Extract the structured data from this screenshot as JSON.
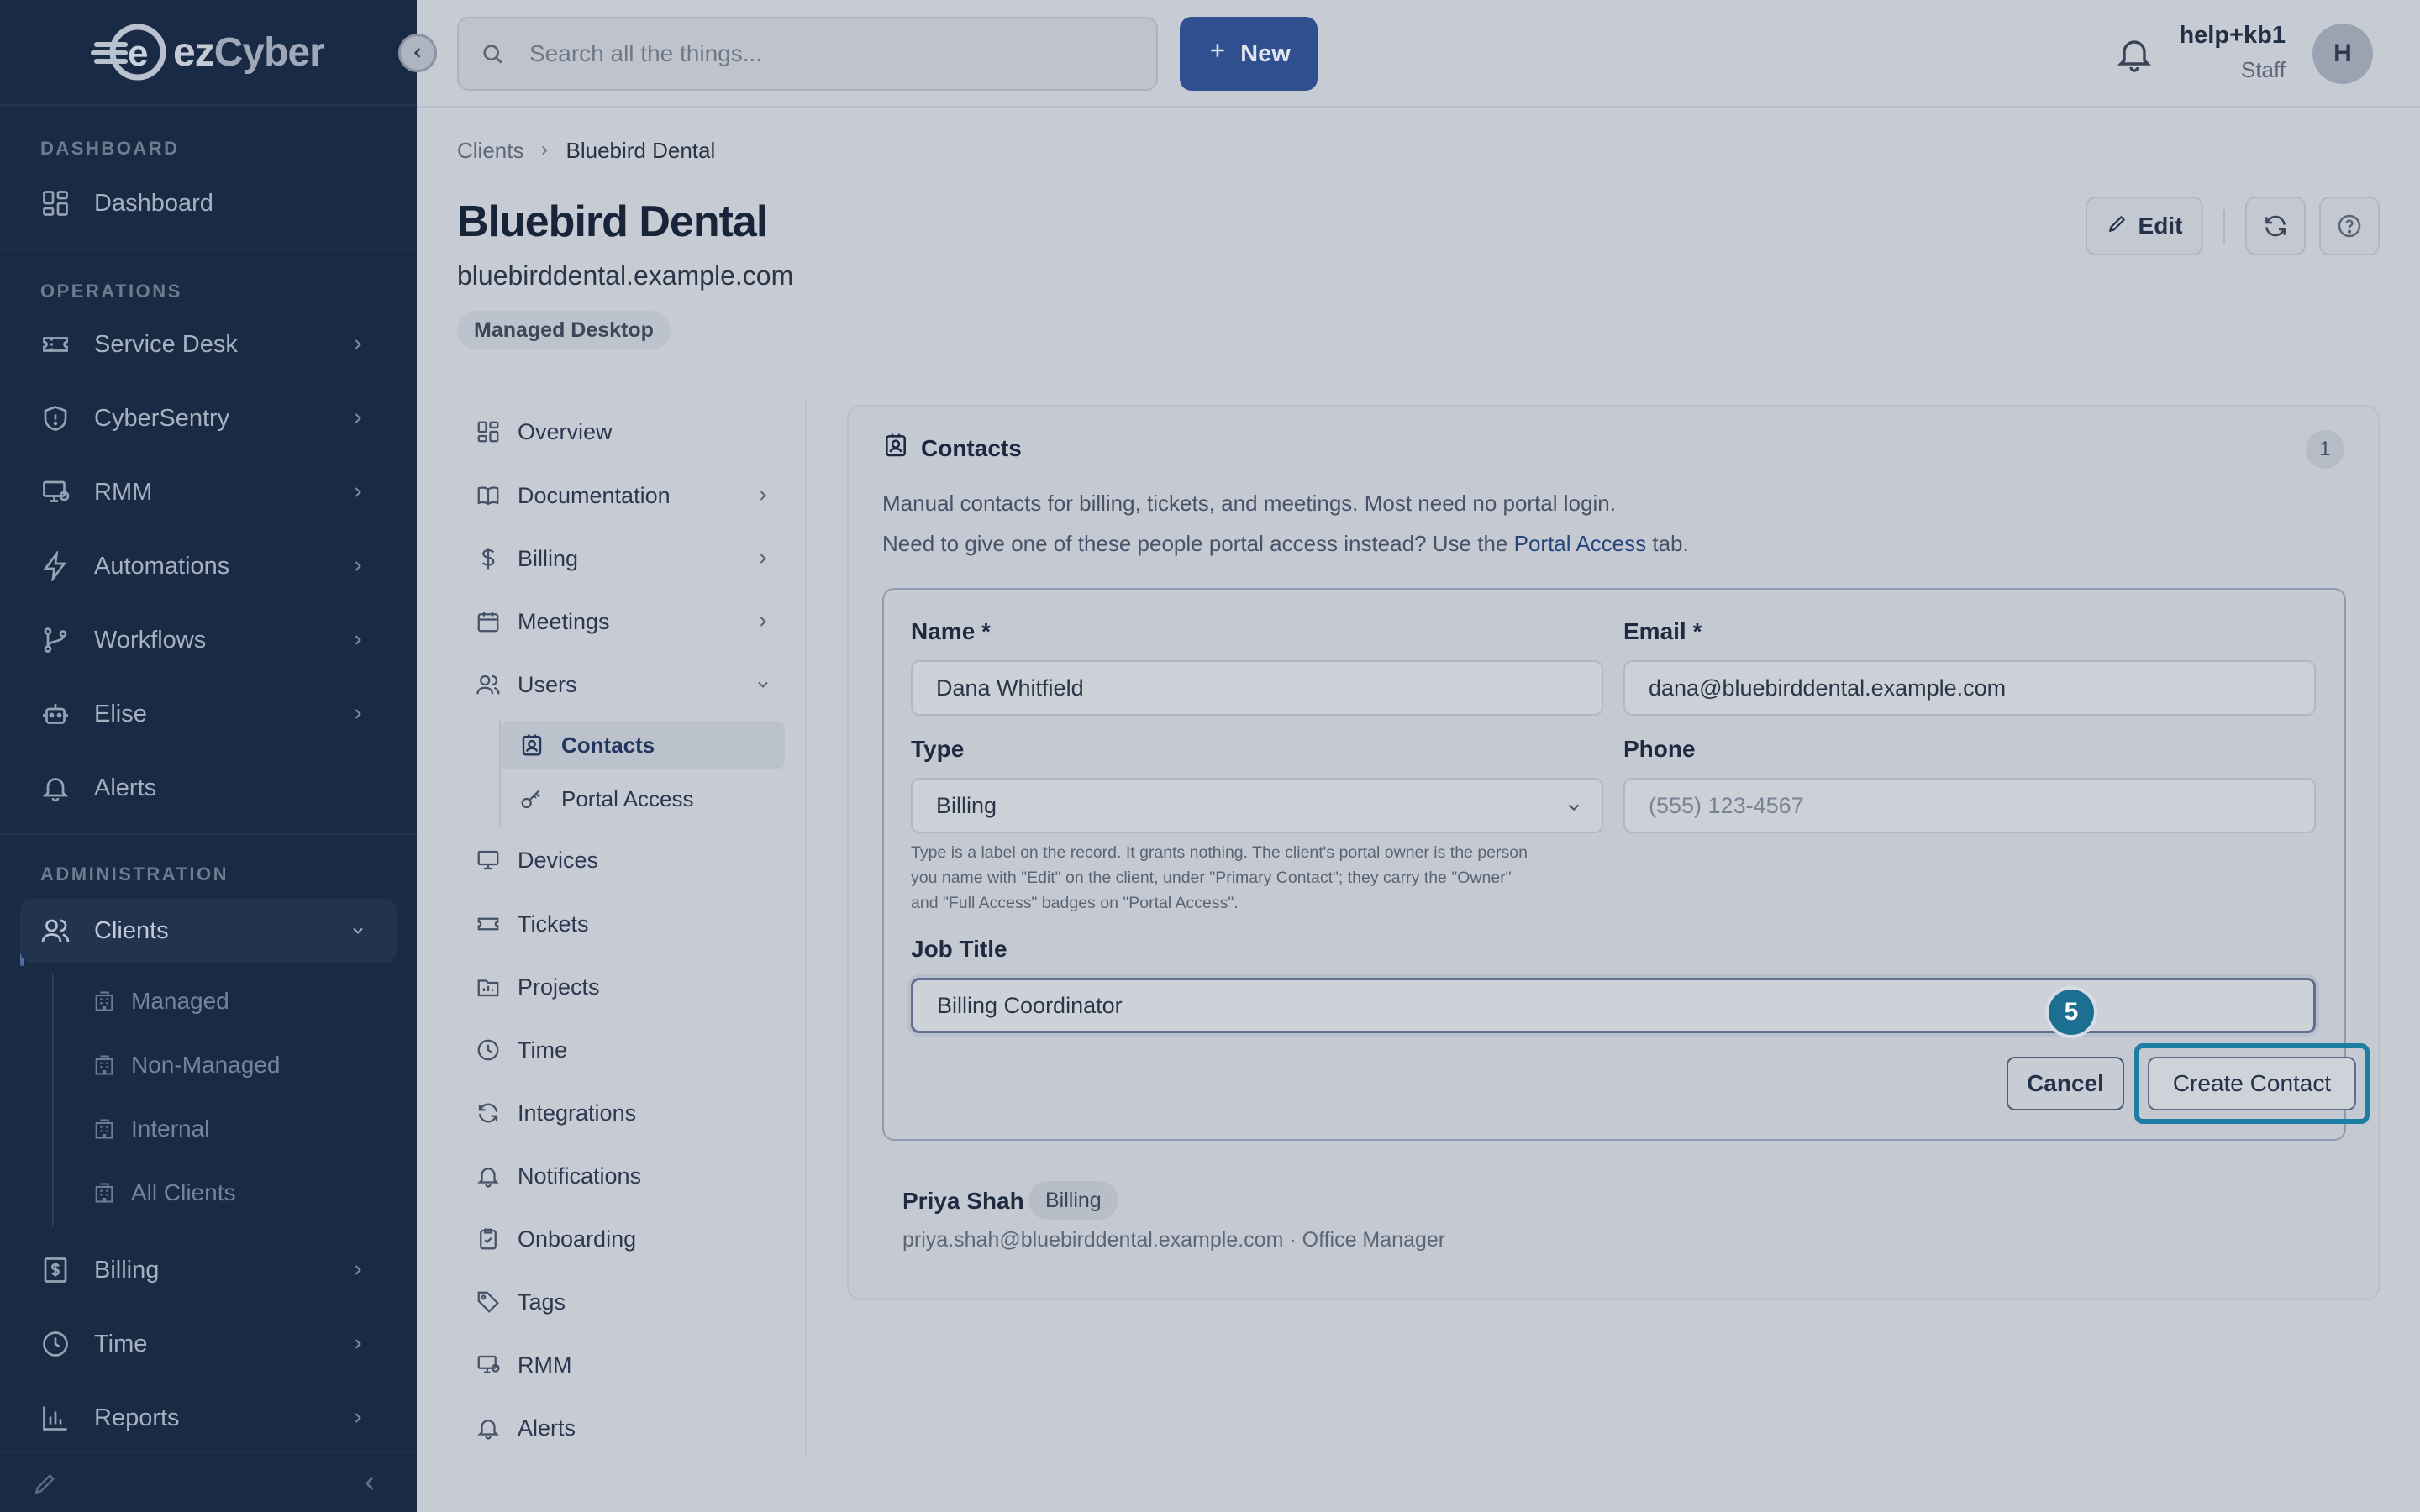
{
  "brand": {
    "ez": "ez",
    "cyber": "Cyber"
  },
  "sidebar": {
    "sections": {
      "dashboard": "DASHBOARD",
      "operations": "OPERATIONS",
      "administration": "ADMINISTRATION"
    },
    "items": {
      "dashboard": "Dashboard",
      "service_desk": "Service Desk",
      "cybersentry": "CyberSentry",
      "rmm": "RMM",
      "automations": "Automations",
      "workflows": "Workflows",
      "elise": "Elise",
      "alerts": "Alerts",
      "clients": "Clients",
      "billing": "Billing",
      "time": "Time",
      "reports": "Reports"
    },
    "client_sub": {
      "managed": "Managed",
      "non_managed": "Non-Managed",
      "internal": "Internal",
      "all": "All Clients"
    }
  },
  "topbar": {
    "search_placeholder": "Search all the things...",
    "new_label": "New",
    "user_name": "help+kb1",
    "user_role": "Staff",
    "avatar_initial": "H"
  },
  "header": {
    "breadcrumb_root": "Clients",
    "breadcrumb_current": "Bluebird Dental",
    "title": "Bluebird Dental",
    "domain": "bluebirddental.example.com",
    "tag": "Managed Desktop",
    "edit_label": "Edit"
  },
  "client_nav": {
    "overview": "Overview",
    "documentation": "Documentation",
    "billing": "Billing",
    "meetings": "Meetings",
    "users": "Users",
    "contacts": "Contacts",
    "portal_access": "Portal Access",
    "devices": "Devices",
    "tickets": "Tickets",
    "projects": "Projects",
    "time": "Time",
    "integrations": "Integrations",
    "notifications": "Notifications",
    "onboarding": "Onboarding",
    "tags": "Tags",
    "rmm": "RMM",
    "alerts": "Alerts"
  },
  "contacts_card": {
    "title": "Contacts",
    "count": "1",
    "desc1": "Manual contacts for billing, tickets, and meetings. Most need no portal login.",
    "desc2_prefix": "Need to give one of these people portal access instead? Use the ",
    "desc2_link": "Portal Access",
    "desc2_suffix": " tab.",
    "form": {
      "name_label": "Name *",
      "name_value": "Dana Whitfield",
      "email_label": "Email *",
      "email_value": "dana@bluebirddental.example.com",
      "type_label": "Type",
      "type_value": "Billing",
      "phone_label": "Phone",
      "phone_placeholder": "(555) 123-4567",
      "type_hint_1": "Type is a label on the record. It grants nothing. The client's portal owner is the person",
      "type_hint_2": "you name with \"Edit\" on the client, under \"Primary Contact\"; they carry the \"Owner\"",
      "type_hint_3": "and \"Full Access\" badges on \"Portal Access\".",
      "job_title_label": "Job Title",
      "job_title_value": "Billing Coordinator",
      "cancel_label": "Cancel",
      "create_label": "Create Contact",
      "step_number": "5"
    },
    "existing": {
      "name": "Priya Shah",
      "badge": "Billing",
      "meta": "priya.shah@bluebirddental.example.com · Office Manager"
    }
  },
  "colors": {
    "sidebar_bg": "#192a44",
    "primary": "#2f4f8f",
    "highlight": "#1d7ea3"
  }
}
